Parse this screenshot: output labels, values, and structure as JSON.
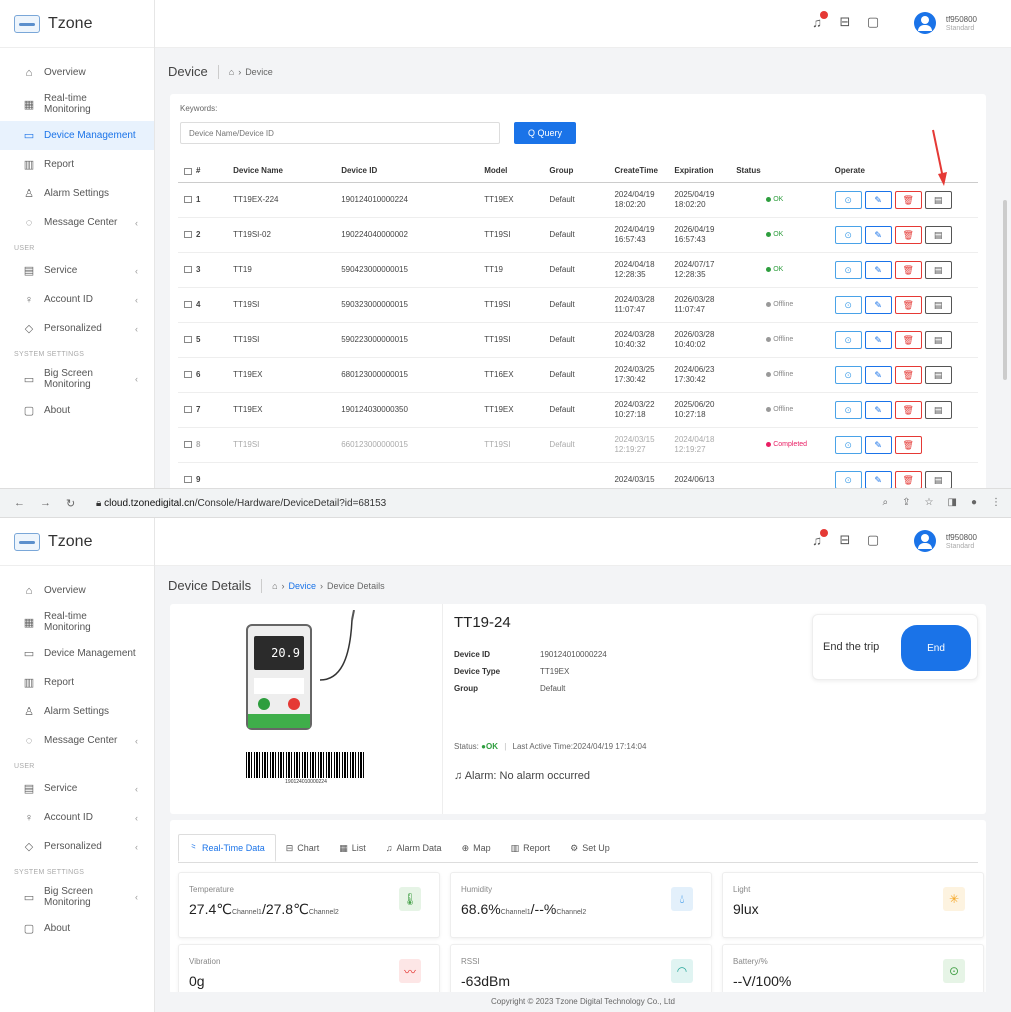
{
  "app": {
    "name": "Tzone"
  },
  "header": {
    "username": "tf950800",
    "role": "Standard"
  },
  "sidebar": {
    "items": [
      {
        "label": "Overview",
        "icon": "home-icon"
      },
      {
        "label": "Real-time Monitoring",
        "icon": "grid-icon"
      },
      {
        "label": "Device Management",
        "icon": "device-icon"
      },
      {
        "label": "Report",
        "icon": "report-icon"
      },
      {
        "label": "Alarm Settings",
        "icon": "alarm-icon"
      },
      {
        "label": "Message Center",
        "icon": "message-icon"
      }
    ],
    "group_user": "USER",
    "user_items": [
      {
        "label": "Service",
        "icon": "service-icon"
      },
      {
        "label": "Account ID",
        "icon": "user-icon"
      },
      {
        "label": "Personalized",
        "icon": "personalize-icon"
      }
    ],
    "group_system": "SYSTEM SETTINGS",
    "system_items": [
      {
        "label": "Big Screen Monitoring",
        "icon": "monitor-icon"
      },
      {
        "label": "About",
        "icon": "info-icon"
      }
    ]
  },
  "device_list": {
    "breadcrumb_title": "Device",
    "breadcrumb_current": "Device",
    "keywords_label": "Keywords:",
    "search_placeholder": "Device Name/Device ID",
    "query_label": "Q Query",
    "columns": [
      "#",
      "Device Name",
      "Device ID",
      "Model",
      "Group",
      "CreateTime",
      "Expiration",
      "Status",
      "Operate"
    ],
    "rows": [
      {
        "no": "1",
        "name": "TT19EX-224",
        "id": "190124010000224",
        "model": "TT19EX",
        "group": "Default",
        "create": "2024/04/19 18:02:20",
        "exp": "2025/04/19 18:02:20",
        "status": "OK",
        "status_color": "#2e9e3e",
        "ops": 4
      },
      {
        "no": "2",
        "name": "TT19SI-02",
        "id": "190224040000002",
        "model": "TT19SI",
        "group": "Default",
        "create": "2024/04/19 16:57:43",
        "exp": "2026/04/19 16:57:43",
        "status": "OK",
        "status_color": "#2e9e3e",
        "ops": 4
      },
      {
        "no": "3",
        "name": "TT19",
        "id": "590423000000015",
        "model": "TT19",
        "group": "Default",
        "create": "2024/04/18 12:28:35",
        "exp": "2024/07/17 12:28:35",
        "status": "OK",
        "status_color": "#2e9e3e",
        "ops": 4
      },
      {
        "no": "4",
        "name": "TT19SI",
        "id": "590323000000015",
        "model": "TT19SI",
        "group": "Default",
        "create": "2024/03/28 11:07:47",
        "exp": "2026/03/28 11:07:47",
        "status": "Offline",
        "status_color": "#999999",
        "ops": 4
      },
      {
        "no": "5",
        "name": "TT19SI",
        "id": "590223000000015",
        "model": "TT19SI",
        "group": "Default",
        "create": "2024/03/28 10:40:32",
        "exp": "2026/03/28 10:40:02",
        "status": "Offline",
        "status_color": "#999999",
        "ops": 4
      },
      {
        "no": "6",
        "name": "TT19EX",
        "id": "680123000000015",
        "model": "TT16EX",
        "group": "Default",
        "create": "2024/03/25 17:30:42",
        "exp": "2024/06/23 17:30:42",
        "status": "Offline",
        "status_color": "#999999",
        "ops": 4
      },
      {
        "no": "7",
        "name": "TT19EX",
        "id": "190124030000350",
        "model": "TT19EX",
        "group": "Default",
        "create": "2024/03/22 10:27:18",
        "exp": "2025/06/20 10:27:18",
        "status": "Offline",
        "status_color": "#999999",
        "ops": 4
      },
      {
        "no": "8",
        "name": "TT19SI",
        "id": "660123000000015",
        "model": "TT19SI",
        "group": "Default",
        "create": "2024/03/15 12:19:27",
        "exp": "2024/04/18 12:19:27",
        "status": "Completed",
        "status_color": "#e91e63",
        "ops": 3,
        "dim": true
      },
      {
        "no": "9",
        "name": "",
        "id": "",
        "model": "",
        "group": "",
        "create": "2024/03/15",
        "exp": "2024/06/13",
        "status": "",
        "status_color": "#999999",
        "ops": 4
      }
    ]
  },
  "browser": {
    "url_host": "cloud.tzonedigital.cn",
    "url_path": "/Console/Hardware/DeviceDetail?id=68153"
  },
  "device_detail": {
    "breadcrumb_title": "Device Details",
    "breadcrumb_device": "Device",
    "breadcrumb_current": "Device Details",
    "title": "TT19-24",
    "fields": [
      {
        "k": "Device ID",
        "v": "190124010000224"
      },
      {
        "k": "Device Type",
        "v": "TT19EX"
      },
      {
        "k": "Group",
        "v": "Default"
      }
    ],
    "barcode_text": "190124010000224",
    "device_screen_value": "20.9",
    "status_label": "Status:",
    "status_value": "OK",
    "last_active": "Last Active Time:2024/04/19 17:14:04",
    "alarm_text": "Alarm: No alarm occurred",
    "end_trip_label": "End the trip",
    "end_button": "End",
    "tabs": [
      "Real-Time Data",
      "Chart",
      "List",
      "Alarm Data",
      "Map",
      "Report",
      "Set Up"
    ],
    "metrics": [
      {
        "label": "Temperature",
        "value": "27.4℃",
        "sub": "Channel1",
        "value2": "/27.8℃",
        "sub2": "Channel2",
        "icon": "thermometer-icon",
        "color": "#43a047",
        "bg": "#e6f4e6"
      },
      {
        "label": "Humidity",
        "value": "68.6%",
        "sub": "Channel1",
        "value2": "/--%",
        "sub2": "Channel2",
        "icon": "humidity-icon",
        "color": "#1e88e5",
        "bg": "#e3f0fb"
      },
      {
        "label": "Light",
        "value": "9lux",
        "icon": "light-icon",
        "color": "#f5a623",
        "bg": "#fdf3e0"
      },
      {
        "label": "Vibration",
        "value": "0g",
        "icon": "vibration-icon",
        "color": "#e53935",
        "bg": "#fde6e6"
      },
      {
        "label": "RSSI",
        "value": "-63dBm",
        "icon": "wifi-icon",
        "color": "#26a69a",
        "bg": "#e0f4f2"
      },
      {
        "label": "Battery/%",
        "value": "--V/100%",
        "icon": "battery-icon",
        "color": "#43a047",
        "bg": "#e6f4e6"
      }
    ],
    "footer": "Copyright © 2023 Tzone Digital Technology Co., Ltd"
  }
}
